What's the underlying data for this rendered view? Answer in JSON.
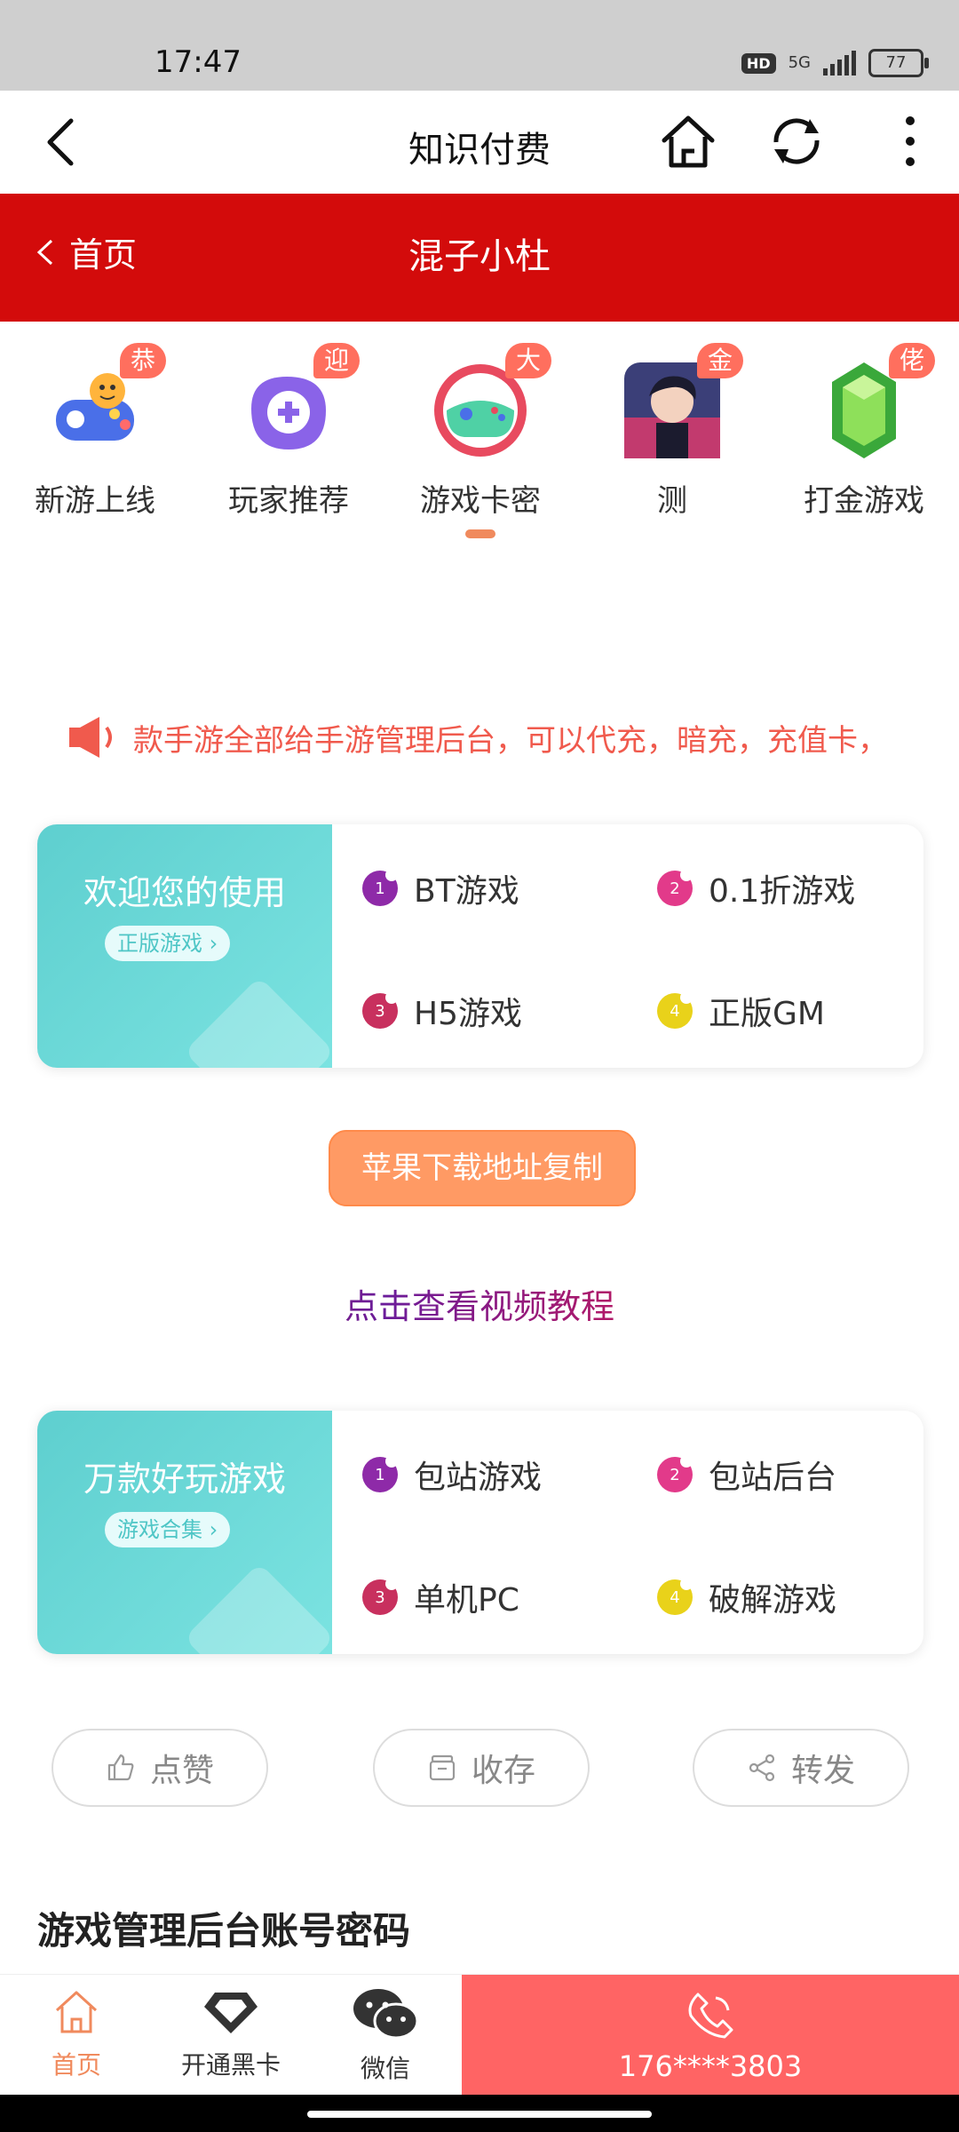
{
  "status": {
    "time": "17:47",
    "hd": "HD",
    "net": "5G",
    "battery": "77"
  },
  "appbar": {
    "title": "知识付费"
  },
  "header": {
    "home_label": "首页",
    "title": "混子小杜"
  },
  "categories": [
    {
      "label": "新游上线",
      "badge": "恭",
      "icon": "gamepad-mascot-icon"
    },
    {
      "label": "玩家推荐",
      "badge": "迎",
      "icon": "purple-controller-icon"
    },
    {
      "label": "游戏卡密",
      "badge": "大",
      "icon": "controller-ring-icon"
    },
    {
      "label": "测",
      "badge": "金",
      "icon": "character-avatar-icon"
    },
    {
      "label": "打金游戏",
      "badge": "佬",
      "icon": "green-gem-icon"
    }
  ],
  "notice": {
    "text": "款手游全部给手游管理后台，可以代充，暗充，充值卡，"
  },
  "card1": {
    "title": "欢迎您的使用",
    "pill": "正版游戏 ›",
    "items": [
      "BT游戏",
      "0.1折游戏",
      "H5游戏",
      "正版GM"
    ],
    "nums": [
      "1",
      "2",
      "3",
      "4"
    ]
  },
  "apple_button": "苹果下载地址复制",
  "video_link": "点击查看视频教程",
  "card2": {
    "title": "万款好玩游戏",
    "pill": "游戏合集 ›",
    "items": [
      "包站游戏",
      "包站后台",
      "单机PC",
      "破解游戏"
    ],
    "nums": [
      "1",
      "2",
      "3",
      "4"
    ]
  },
  "actions": {
    "like": "点赞",
    "save": "收存",
    "share": "转发"
  },
  "section_title": "游戏管理后台账号密码",
  "bottom": {
    "home": "首页",
    "vip": "开通黑卡",
    "wechat": "微信",
    "phone": "176****3803"
  },
  "colors": {
    "red": "#d30b0b",
    "teal": "#5ecfcf",
    "orange": "#ff9a64",
    "call": "#ff6464"
  }
}
